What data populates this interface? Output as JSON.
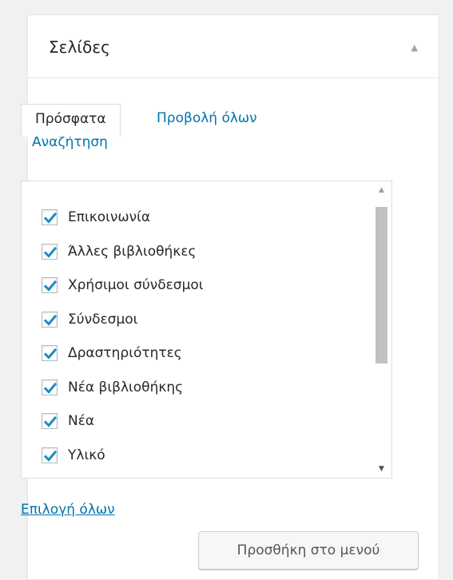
{
  "panel": {
    "title": "Σελίδες",
    "toggle_icon": "arrow-up-icon"
  },
  "tabs": {
    "recent": "Πρόσφατα",
    "view_all": "Προβολή όλων",
    "search": "Αναζήτηση"
  },
  "items": [
    {
      "label": "Επικοινωνία",
      "checked": true
    },
    {
      "label": "Άλλες βιβλιοθήκες",
      "checked": true
    },
    {
      "label": "Χρήσιμοι σύνδεσμοι",
      "checked": true
    },
    {
      "label": "Σύνδεσμοι",
      "checked": true
    },
    {
      "label": "Δραστηριότητες",
      "checked": true
    },
    {
      "label": "Νέα βιβλιοθήκης",
      "checked": true
    },
    {
      "label": "Νέα",
      "checked": true
    },
    {
      "label": "Υλικό",
      "checked": true
    }
  ],
  "select_all": "Επιλογή όλων",
  "add_button": "Προσθήκη στο μενού",
  "colors": {
    "link": "#0073aa",
    "check": "#1e8cbe",
    "border": "#dcdcde"
  }
}
